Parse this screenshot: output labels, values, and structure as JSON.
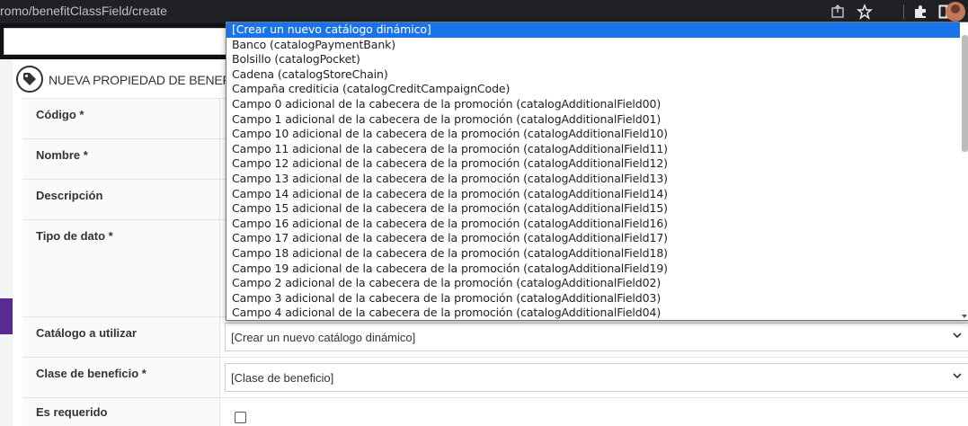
{
  "browser": {
    "url": "romo/benefitClassField/create",
    "icons": [
      "share-icon",
      "star-icon",
      "extensions-icon",
      "sidebar-icon",
      "profile-avatar"
    ]
  },
  "page": {
    "title": "NUEVA PROPIEDAD DE BENEF",
    "title_icon": "tag-icon"
  },
  "form": {
    "fields": [
      {
        "label": "Código *"
      },
      {
        "label": "Nombre *"
      },
      {
        "label": "Descripción"
      },
      {
        "label": "Tipo de dato *"
      },
      {
        "label": "Catálogo a utilizar"
      },
      {
        "label": "Clase de beneficio *"
      },
      {
        "label": "Es requerido"
      }
    ],
    "catalog_select_value": "[Crear un nuevo catálogo dinámico]",
    "benefit_class_select_value": "[Clase de beneficio]"
  },
  "dropdown": {
    "options": [
      "[Crear un nuevo catálogo dinámico]",
      "Banco (catalogPaymentBank)",
      "Bolsillo (catalogPocket)",
      "Cadena (catalogStoreChain)",
      "Campaña crediticia (catalogCreditCampaignCode)",
      "Campo 0 adicional de la cabecera de la promoción (catalogAdditionalField00)",
      "Campo 1 adicional de la cabecera de la promoción (catalogAdditionalField01)",
      "Campo 10 adicional de la cabecera de la promoción (catalogAdditionalField10)",
      "Campo 11 adicional de la cabecera de la promoción (catalogAdditionalField11)",
      "Campo 12 adicional de la cabecera de la promoción (catalogAdditionalField12)",
      "Campo 13 adicional de la cabecera de la promoción (catalogAdditionalField13)",
      "Campo 14 adicional de la cabecera de la promoción (catalogAdditionalField14)",
      "Campo 15 adicional de la cabecera de la promoción (catalogAdditionalField15)",
      "Campo 16 adicional de la cabecera de la promoción (catalogAdditionalField16)",
      "Campo 17 adicional de la cabecera de la promoción (catalogAdditionalField17)",
      "Campo 18 adicional de la cabecera de la promoción (catalogAdditionalField18)",
      "Campo 19 adicional de la cabecera de la promoción (catalogAdditionalField19)",
      "Campo 2 adicional de la cabecera de la promoción (catalogAdditionalField02)",
      "Campo 3 adicional de la cabecera de la promoción (catalogAdditionalField03)",
      "Campo 4 adicional de la cabecera de la promoción (catalogAdditionalField04)"
    ],
    "selected_index": 0
  },
  "colors": {
    "selected_option_bg": "#1a73e8",
    "chrome_bg": "#202124",
    "accent_purple": "#5b2a91"
  }
}
